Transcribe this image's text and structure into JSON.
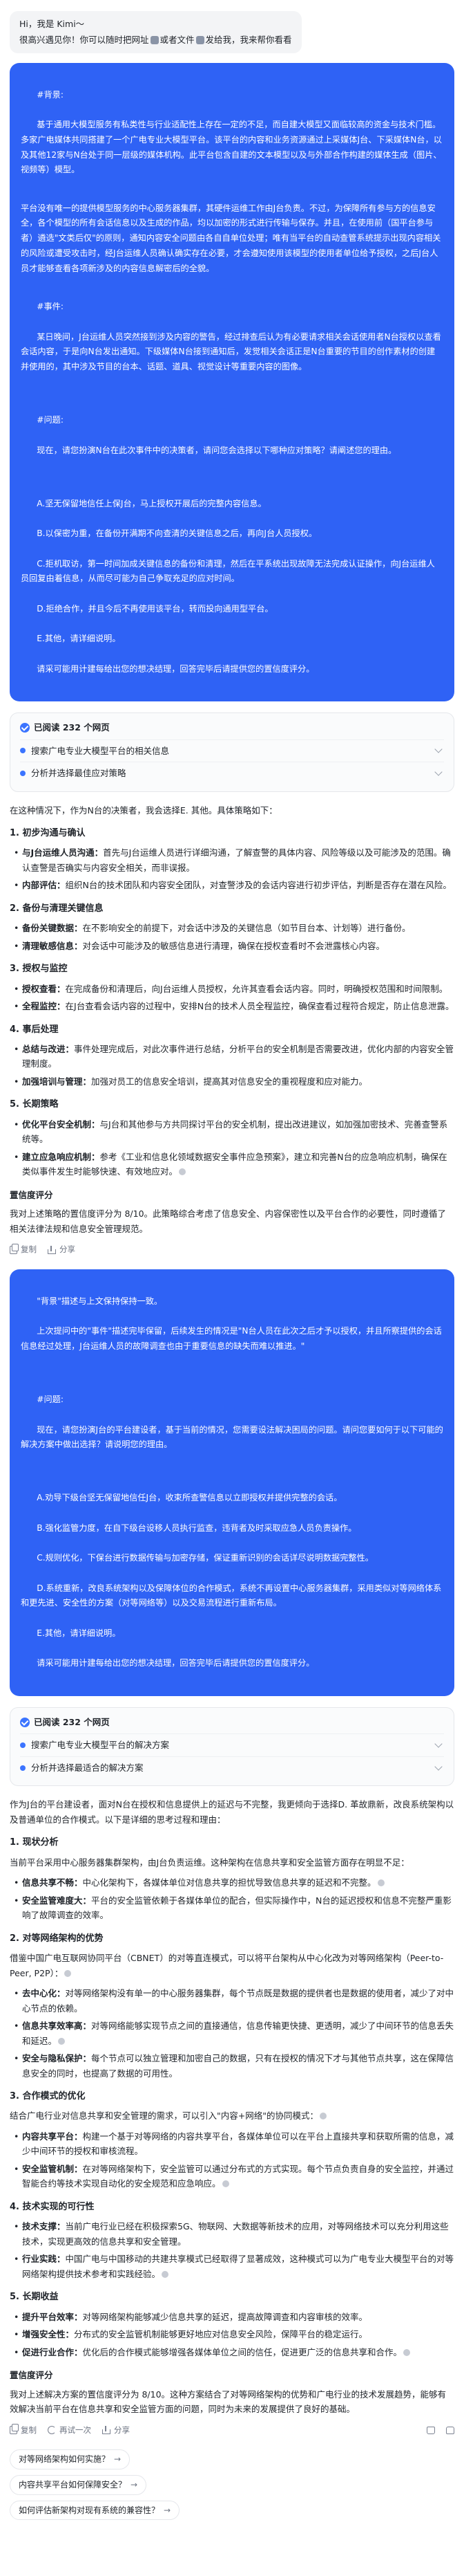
{
  "greeting": {
    "line1": "Hi，我是 Kimi～",
    "line2_a": "很高兴遇见你！你可以随时把网址",
    "line2_b": "或者文件",
    "line2_c": "发给我，我来帮你看看"
  },
  "question1": {
    "background_label": "#背景:",
    "background_text": "基于通用大模型服务有私类性与行业适配性上存在一定的不足，而自建大模型又面临较高的资金与技术门槛。多家广电媒体共同搭建了一个广电专业大模型平台。该平台的内容和业务资源通过上采媒体J台、下采媒体N台，以及其他12家与N台处于同一层级的媒体机构。此平台包含自建的文本模型以及与外部合作构建的媒体生成（图片、视频等）模型。",
    "p2": "平台没有唯一的提供模型服务的中心服务器集群，其硬件运维工作由J台负责。不过，为保障所有参与方的信息安全，各个模型的所有会话信息以及生成的作品，均以加密的形式进行传输与保存。并且，在使用前（国平台参与者）遴选\"文类后仅\"的原则，通知内容安全问题由各自自单位处理；唯有当平台的自动查管系统提示出现内容相关的风险或遭受攻击时，经J台运维人员确认确实存在必要，才会遵知使用该模型的使用者单位给予授权，之后J台人员才能够查看各项新涉及的内容信息解密后的全貌。",
    "event_label": "#事件:",
    "event_text": "某日晚间，J台运维人员突然接到涉及内容的警告，经过排查后认为有必要请求相关会话使用者N台授权以查看会话内容，于是向N台发出通知。下级媒体N台接到通知后，发觉相关会话正是N台重要的节目的创作素材的创建并使用的，其中涉及节目的台本、话题、道具、视觉设计等重要内容的图像。",
    "q_label": "#问题:",
    "q_text": "现在，请您扮演N台在此次事件中的决策者，请问您会选择以下哪种应对策略？请阐述您的理由。",
    "options": [
      "A.坚无保留地信任上保J台，马上授权开展后的完整内容信息。",
      "B.以保密为重，在备份开满期不向查清的关键信息之后，再向J台人员授权。",
      "C.拒机取访，第一时间加成关键信息的备份和清理，然后在平系统出现故障无法完成认证操作，向J台运维人员回复由着信息，从而尽可能为自己争取充足的应对时间。",
      "D.拒绝合作，并且今后不再使用该平台，转而投向通用型平台。",
      "E.其他，请详细说明。"
    ],
    "instruction": "请采可能用计建每给出您的想决结理，回答完毕后请提供您的置信度评分。"
  },
  "search1": {
    "title": "已阅读 232 个网页",
    "items": [
      "搜索广电专业大模型平台的相关信息",
      "分析并选择最佳应对策略"
    ]
  },
  "answer1": {
    "intro": "在这种情况下，作为N台的决策者，我会选择E. 其他。具体策略如下：",
    "sections": [
      {
        "title": "1. 初步沟通与确认",
        "items": [
          {
            "head": "与J台运维人员沟通：",
            "body": "首先与J台运维人员进行详细沟通，了解查警的具体内容、风险等级以及可能涉及的范围。确认查警是否确实与内容安全相关，而非误报。"
          },
          {
            "head": "内部评估：",
            "body": "组织N台的技术团队和内容安全团队，对查警涉及的会话内容进行初步评估，判断是否存在潜在风险。"
          }
        ]
      },
      {
        "title": "2. 备份与清理关键信息",
        "items": [
          {
            "head": "备份关键数据：",
            "body": "在不影响安全的前提下，对会话中涉及的关键信息（如节目台本、计划等）进行备份。"
          },
          {
            "head": "清理敏感信息：",
            "body": "对会话中可能涉及的敏感信息进行清理，确保在授权查看时不会泄露核心内容。"
          }
        ]
      },
      {
        "title": "3. 授权与监控",
        "items": [
          {
            "head": "授权查看：",
            "body": "在完成备份和清理后，向J台运维人员授权，允许其查看会话内容。同时，明确授权范围和时间限制。"
          },
          {
            "head": "全程监控：",
            "body": "在J台查看会话内容的过程中，安排N台的技术人员全程监控，确保查看过程符合规定，防止信息泄露。"
          }
        ]
      },
      {
        "title": "4. 事后处理",
        "items": [
          {
            "head": "总结与改进：",
            "body": "事件处理完成后，对此次事件进行总结，分析平台的安全机制是否需要改进，优化内部的内容安全管理制度。"
          },
          {
            "head": "加强培训与管理：",
            "body": "加强对员工的信息安全培训，提高其对信息安全的重视程度和应对能力。"
          }
        ]
      },
      {
        "title": "5. 长期策略",
        "items": [
          {
            "head": "优化平台安全机制：",
            "body": "与J台和其他参与方共同探讨平台的安全机制，提出改进建议，如加强加密技术、完善查警系统等。"
          },
          {
            "head": "建立应急响应机制：",
            "body": "参考《工业和信息化领域数据安全事件应急预案》，建立和完善N台的应急响应机制，确保在类似事件发生时能够快速、有效地应对。"
          }
        ]
      }
    ],
    "eval_title": "置信度评分",
    "eval_text": "我对上述策略的置信度评分为 8/10。此策略综合考虑了信息安全、内容保密性以及平台合作的必要性，同时遵循了相关法律法规和信息安全管理规范。"
  },
  "actions1": {
    "copy": "复制",
    "share": "分享"
  },
  "question2": {
    "line1": "\"背景\"描述与上文保持保持一致。",
    "line2": "上次提问中的\"事件\"描述完毕保留，后续发生的情况是\"N台人员在此次之后才予以授权，并且所察提供的会话信息经过处理，J台运维人员的故障调查也由于重要信息的缺失而难以推进。\"",
    "q_label": "#问题:",
    "q_text": "现在，请您扮演J台的平台建设者，基于当前的情况，您需要设法解决困局的问题。请问您要如何于以下可能的解决方案中做出选择？请说明您的理由。",
    "options": [
      "A.劝导下级台坚无保留地信任J台，收束所查警信息以立即授权并提供完整的会话。",
      "B.强化监管力度，在自下级台设移人员执行监查，违背者及时采取应急人员负责操作。",
      "C.规则优化，下保台进行数据传输与加密存储，保证重新识别的会话详尽说明数据完整性。",
      "D.系统重新，改良系统架构以及保障体位的合作模式，系统不再设置中心服务器集群，采用类似对等网络体系和更先进、安全性的方案（对等网络等）以及交易流程进行重新布局。",
      "E.其他，请详细说明。"
    ],
    "instruction": "请采可能用计建每给出您的想决结理，回答完毕后请提供您的置信度评分。"
  },
  "search2": {
    "title": "已阅读 232 个网页",
    "items": [
      "搜索广电专业大模型平台的解决方案",
      "分析并选择最适合的解决方案"
    ]
  },
  "answer2": {
    "intro": "作为J台的平台建设者，面对N台在授权和信息提供上的延迟与不完整，我更倾向于选择D. 革故鼎新，改良系统架构以及普通单位的合作模式。以下是详细的思考过程和理由：",
    "sections": [
      {
        "title": "1. 现状分析",
        "lead": "当前平台采用中心服务器集群架构，由J台负责运维。这种架构在信息共享和安全监管方面存在明显不足：",
        "items": [
          {
            "head": "信息共享不畅：",
            "body": "中心化架构下，各媒体单位对信息共享的担忧导致信息共享的延迟和不完整。"
          },
          {
            "head": "安全监管难度大：",
            "body": "平台的安全监管依赖于各媒体单位的配合，但实际操作中，N台的延迟授权和信息不完整严重影响了故障调查的效率。"
          }
        ]
      },
      {
        "title": "2. 对等网络架构的优势",
        "lead": "借鉴中国广电互联网协同平台（CBNET）的对等直连模式，可以将平台架构从中心化改为对等网络架构（Peer-to-Peer, P2P）：",
        "items": [
          {
            "head": "去中心化：",
            "body": "对等网络架构没有单一的中心服务器集群，每个节点既是数据的提供者也是数据的使用者，减少了对中心节点的依赖。"
          },
          {
            "head": "信息共享效率高：",
            "body": "对等网络能够实现节点之间的直接通信，信息传输更快捷、更透明，减少了中间环节的信息丢失和延迟。"
          },
          {
            "head": "安全与隐私保护：",
            "body": "每个节点可以独立管理和加密自己的数据，只有在授权的情况下才与其他节点共享，这在保障信息安全的同时，也提高了数据的可用性。"
          }
        ]
      },
      {
        "title": "3. 合作模式的优化",
        "lead": "结合广电行业对信息共享和安全管理的需求，可以引入\"内容+网络\"的协同模式：",
        "items": [
          {
            "head": "内容共享平台：",
            "body": "构建一个基于对等网络的内容共享平台，各媒体单位可以在平台上直接共享和获取所需的信息，减少中间环节的授权和审核流程。"
          },
          {
            "head": "安全监管机制：",
            "body": "在对等网络架构下，安全监管可以通过分布式的方式实现。每个节点负责自身的安全监控，并通过智能合约等技术实现自动化的安全规范和应急响应。"
          }
        ]
      },
      {
        "title": "4. 技术实现的可行性",
        "items": [
          {
            "head": "技术支撑：",
            "body": "当前广电行业已经在积极探索5G、物联网、大数据等新技术的应用，对等网络技术可以充分利用这些技术，实现更高效的信息共享和安全管理。"
          },
          {
            "head": "行业实践：",
            "body": "中国广电与中国移动的共建共享模式已经取得了显著成效，这种模式可以为广电专业大模型平台的对等网络架构提供技术参考和实践经验。"
          }
        ]
      },
      {
        "title": "5. 长期收益",
        "items": [
          {
            "head": "提升平台效率：",
            "body": "对等网络架构能够减少信息共享的延迟，提高故障调查和内容审核的效率。"
          },
          {
            "head": "增强安全性：",
            "body": "分布式的安全监管机制能够更好地应对信息安全风险，保障平台的稳定运行。"
          },
          {
            "head": "促进行业合作：",
            "body": "优化后的合作模式能够增强各媒体单位之间的信任，促进更广泛的信息共享和合作。"
          }
        ]
      }
    ],
    "eval_title": "置信度评分",
    "eval_text": "我对上述解决方案的置信度评分为 8/10。这种方案结合了对等网络架构的优势和广电行业的技术发展趋势，能够有效解决当前平台在信息共享和安全监管方面的问题，同时为未来的发展提供了良好的基础。"
  },
  "actions2": {
    "copy": "复制",
    "redo": "再试一次",
    "share": "分享"
  },
  "suggestions": [
    "对等网络架构如何实施？",
    "内容共享平台如何保障安全？",
    "如何评估新架构对现有系统的兼容性？"
  ]
}
